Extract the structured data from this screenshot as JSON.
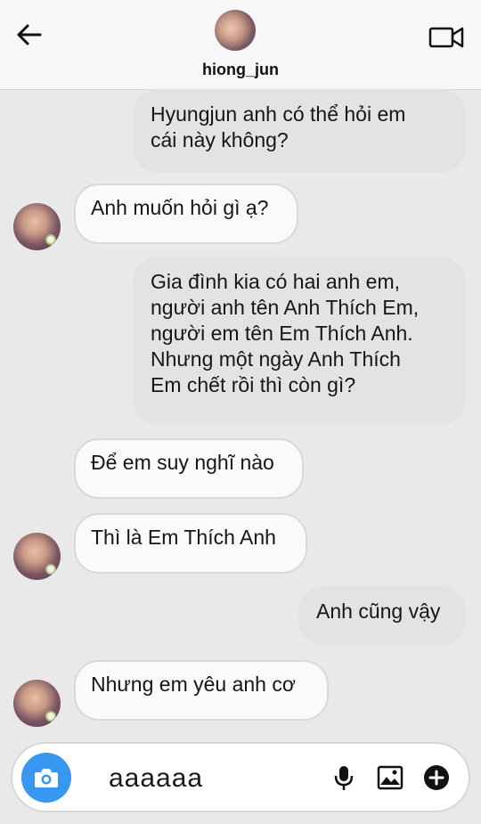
{
  "header": {
    "username": "hiong_jun"
  },
  "messages": [
    {
      "direction": "out",
      "text": "Hyungjun anh có thể hỏi em\ncái này không?"
    },
    {
      "direction": "in",
      "text": "Anh muốn hỏi gì ạ?"
    },
    {
      "direction": "out",
      "text": "Gia đình kia có hai anh em,\nngười anh tên Anh Thích Em,\nngười em tên Em Thích Anh.\nNhưng một ngày Anh Thích\nEm chết rồi thì còn gì?"
    },
    {
      "direction": "in",
      "text": "Để em suy nghĩ nào"
    },
    {
      "direction": "in",
      "text": "Thì là Em Thích Anh"
    },
    {
      "direction": "out",
      "text": "Anh cũng vậy"
    },
    {
      "direction": "in",
      "text": "Nhưng em yêu anh cơ"
    }
  ],
  "composer": {
    "value": "aaaaaa"
  },
  "icons": {
    "back": "back-arrow-icon",
    "video": "video-call-icon",
    "camera": "camera-icon",
    "mic": "microphone-icon",
    "gallery": "gallery-icon",
    "add": "plus-circle-icon"
  },
  "colors": {
    "camera_button": "#3897f0",
    "outgoing_bubble": "#e3e3e3",
    "incoming_bubble": "#fafafa",
    "background": "#e9e9e9"
  }
}
